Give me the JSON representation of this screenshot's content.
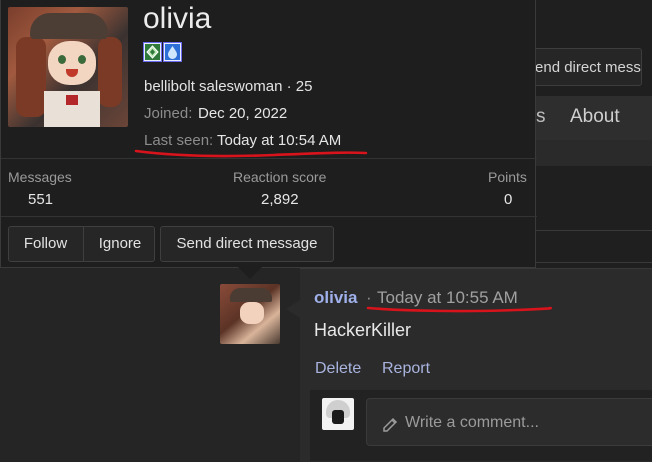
{
  "background": {
    "direct_message_label": "Send direct message",
    "nav_fragment": "s",
    "nav_about": "About"
  },
  "profile_card": {
    "username": "olivia",
    "user_title": "bellibolt saleswoman · 25",
    "joined_label": "Joined:",
    "joined_value": "Dec 20, 2022",
    "last_seen_label": "Last seen:",
    "last_seen_value": "Today at 10:54 AM",
    "stats": [
      {
        "label": "Messages",
        "value": "551"
      },
      {
        "label": "Reaction score",
        "value": "2,892"
      },
      {
        "label": "Points",
        "value": "0"
      }
    ],
    "buttons": {
      "follow": "Follow",
      "ignore": "Ignore",
      "send_dm": "Send direct message"
    },
    "badges": [
      "grass-type-icon",
      "water-type-icon"
    ]
  },
  "post": {
    "username": "olivia",
    "separator": "·",
    "timestamp": "Today at 10:55 AM",
    "text": "HackerKiller",
    "actions": {
      "delete": "Delete",
      "report": "Report"
    },
    "comment_placeholder": "Write a comment..."
  },
  "colors": {
    "username_link": "#9fb0ea",
    "action_link": "#a9b4df",
    "annotation_red": "#d9131b"
  }
}
